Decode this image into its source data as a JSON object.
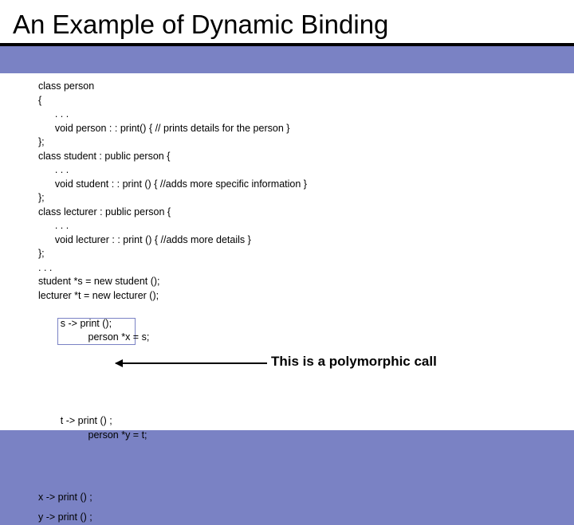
{
  "title": "An Example of Dynamic Binding",
  "code": {
    "l0": "class person",
    "l1": "{",
    "l2": "      . . .",
    "l3": "      void person : : print() { // prints details for the person }",
    "l4": "};",
    "l5": "class student : public person {",
    "l6": "      . . .",
    "l7": "      void student : : print () { //adds more specific information }",
    "l8": "};",
    "l9": "class lecturer : public person {",
    "l10": "      . . .",
    "l11": "      void lecturer : : print () { //adds more details }",
    "l12": "};",
    "l13": ". . .",
    "l14": "student *s = new student ();",
    "l15": "lecturer *t = new lecturer ();",
    "l16a": "s -> print ();",
    "l16b": "person *x = s;",
    "l17a": "t -> print () ;",
    "l17b": "person *y = t;",
    "l18": "x -> print () ;",
    "l19": "y -> print () ;"
  },
  "annotation": "This is a polymorphic call"
}
